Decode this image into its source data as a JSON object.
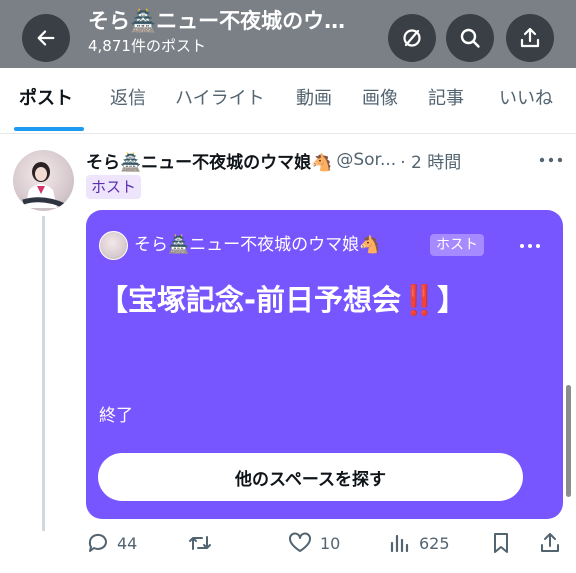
{
  "header": {
    "title": "そら🏯ニュー不夜城のウ…",
    "subtitle": "4,871件のポスト",
    "back_icon": "arrow-left-icon",
    "buttons": [
      "hide-icon",
      "search-icon",
      "share-icon"
    ]
  },
  "tabs": [
    {
      "label": "ポスト",
      "active": true
    },
    {
      "label": "返信",
      "active": false
    },
    {
      "label": "ハイライト",
      "active": false
    },
    {
      "label": "動画",
      "active": false
    },
    {
      "label": "画像",
      "active": false
    },
    {
      "label": "記事",
      "active": false
    },
    {
      "label": "いいね",
      "active": false
    }
  ],
  "post": {
    "author_name": "そら🏯ニュー不夜城のウマ娘🐴",
    "handle": "@Sor...",
    "time": "· 2 時間",
    "host_badge": "ホスト",
    "space": {
      "host_name": "そら🏯ニュー不夜城のウマ娘🐴",
      "host_badge": "ホスト",
      "title": "【宝塚記念-前日予想会‼️】",
      "status": "終了",
      "button_label": "他のスペースを探す",
      "color": "#7856ff"
    },
    "stats": {
      "replies": "44",
      "reposts": "",
      "likes": "10",
      "views": "625"
    }
  },
  "colors": {
    "accent": "#1d9bf0",
    "space_purple": "#7856ff",
    "header_bg": "#7b8087",
    "muted_text": "#536471"
  }
}
